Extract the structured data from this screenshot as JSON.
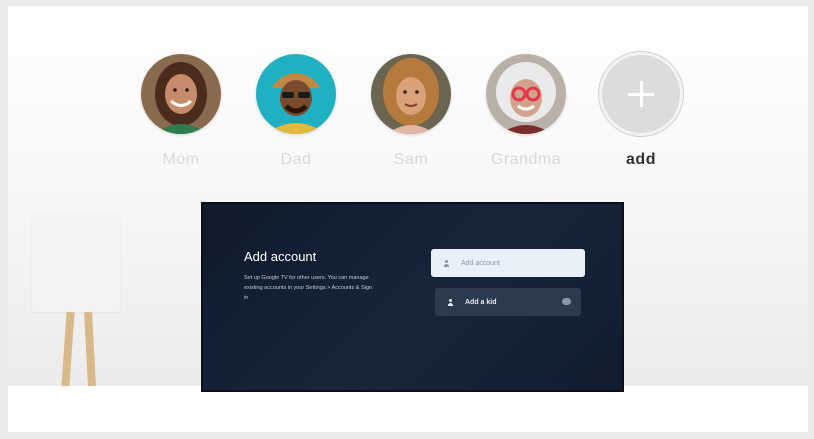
{
  "profiles": [
    {
      "name": "Mom",
      "skin": "#c68b6a",
      "hair": "#4a2c1c",
      "shirt": "#2e7d4f",
      "bg": "#8a6a4e"
    },
    {
      "name": "Dad",
      "skin": "#7a4a2e",
      "hair": "#c08a44",
      "shirt": "#e2b73a",
      "bg": "#1fb0c2"
    },
    {
      "name": "Sam",
      "skin": "#d9a27a",
      "hair": "#b57a3c",
      "shirt": "#e3b6a6",
      "bg": "#6a6450"
    },
    {
      "name": "Grandma",
      "skin": "#d2a38a",
      "hair": "#eaeaea",
      "shirt": "#7a2c2c",
      "bg": "#b9b0a8"
    }
  ],
  "add_profile": {
    "label": "add"
  },
  "tv_screen": {
    "title": "Add account",
    "description": "Set up Google TV for other users. You can manage existing accounts in your Settings > Accounts & Sign in",
    "buttons": [
      {
        "label": "Add account"
      },
      {
        "label": "Add a kid"
      }
    ]
  },
  "colors": {
    "tv_background": "#142036",
    "inactive_name": "#d9d9d9",
    "active_name": "#333333",
    "add_circle": "#dcdcdc"
  }
}
